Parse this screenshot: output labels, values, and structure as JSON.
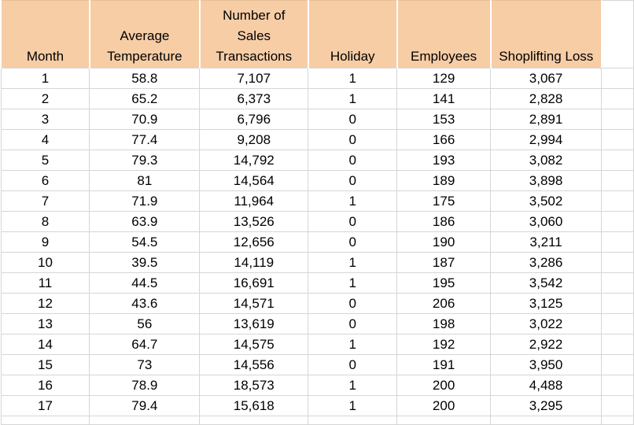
{
  "headers": [
    [
      "Month"
    ],
    [
      "Average",
      "Temperature"
    ],
    [
      "Number of",
      "Sales",
      "Transactions"
    ],
    [
      "Holiday"
    ],
    [
      "Employees"
    ],
    [
      "Shoplifting Loss"
    ]
  ],
  "rows": [
    [
      "1",
      "58.8",
      "7,107",
      "1",
      "129",
      "3,067"
    ],
    [
      "2",
      "65.2",
      "6,373",
      "1",
      "141",
      "2,828"
    ],
    [
      "3",
      "70.9",
      "6,796",
      "0",
      "153",
      "2,891"
    ],
    [
      "4",
      "77.4",
      "9,208",
      "0",
      "166",
      "2,994"
    ],
    [
      "5",
      "79.3",
      "14,792",
      "0",
      "193",
      "3,082"
    ],
    [
      "6",
      "81",
      "14,564",
      "0",
      "189",
      "3,898"
    ],
    [
      "7",
      "71.9",
      "11,964",
      "1",
      "175",
      "3,502"
    ],
    [
      "8",
      "63.9",
      "13,526",
      "0",
      "186",
      "3,060"
    ],
    [
      "9",
      "54.5",
      "12,656",
      "0",
      "190",
      "3,211"
    ],
    [
      "10",
      "39.5",
      "14,119",
      "1",
      "187",
      "3,286"
    ],
    [
      "11",
      "44.5",
      "16,691",
      "1",
      "195",
      "3,542"
    ],
    [
      "12",
      "43.6",
      "14,571",
      "0",
      "206",
      "3,125"
    ],
    [
      "13",
      "56",
      "13,619",
      "0",
      "198",
      "3,022"
    ],
    [
      "14",
      "64.7",
      "14,575",
      "1",
      "192",
      "2,922"
    ],
    [
      "15",
      "73",
      "14,556",
      "0",
      "191",
      "3,950"
    ],
    [
      "16",
      "78.9",
      "18,573",
      "1",
      "200",
      "4,488"
    ],
    [
      "17",
      "79.4",
      "15,618",
      "1",
      "200",
      "3,295"
    ]
  ],
  "colors": {
    "header_fill": "#f7cda6",
    "gridline": "#d6d6d6"
  }
}
